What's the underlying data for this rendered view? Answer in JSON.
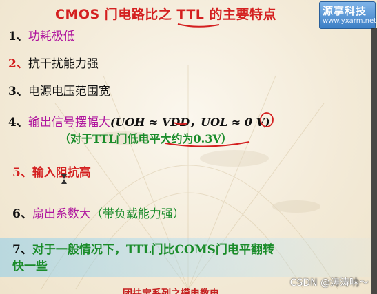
{
  "title": "CMOS 门电路比之 TTL 的主要特点",
  "logo": {
    "name": "源享科技",
    "url": "www.yxarm.net"
  },
  "items": [
    {
      "num": "1、",
      "text": "功耗极低"
    },
    {
      "num": "2、",
      "text": "抗干扰能力强"
    },
    {
      "num": "3、",
      "text": "电源电压范围宽"
    },
    {
      "num": "4、",
      "text": "输出信号摆幅大",
      "formula": "(UOH ≈ VDD，UOL ≈ 0 V)"
    },
    {
      "num": "5、",
      "text": "输入阻抗高"
    },
    {
      "num": "6、",
      "text": "扇出系数大",
      "note": "（带负载能力强）"
    },
    {
      "num": "7、",
      "text": "对于一般情况下，TTL门比COMS门电平翻转",
      "text2": "快一些"
    }
  ],
  "item4_sub": "（对于TTL门低电平大约为0.3V）",
  "footer": "团扶宝系列之模电数电",
  "watermark": "CSDN @涛涛呐～",
  "colors": {
    "title": "#d42020",
    "magenta": "#b0169e",
    "red": "#d42020",
    "black": "#111111",
    "green": "#1a8c2a"
  }
}
